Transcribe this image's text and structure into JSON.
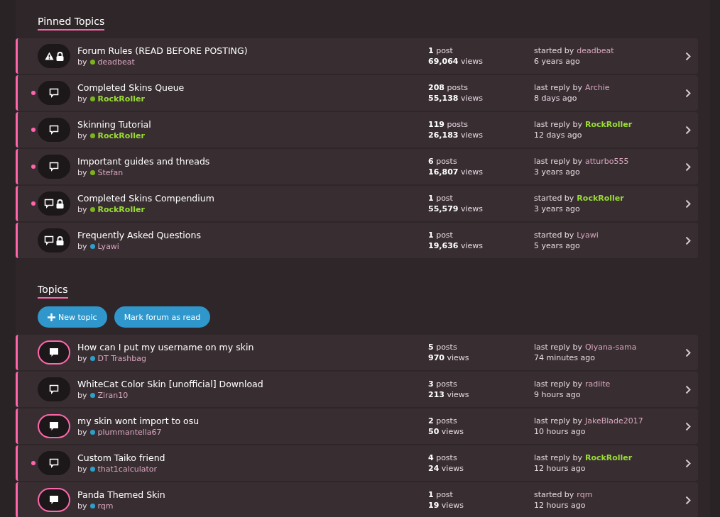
{
  "sections": [
    {
      "title": "Pinned Topics",
      "topics": [
        {
          "title": "Forum Rules (READ BEFORE POSTING)",
          "warning": true,
          "locked": true,
          "unread": false,
          "new_replies": false,
          "by_label": "by",
          "author": {
            "name": "deadbeat",
            "color": "#7ab51d",
            "group_colored": false
          },
          "posts": "**1** post",
          "views": "**69,064** views",
          "last": {
            "label": "started by",
            "name": "deadbeat",
            "group_colored": false,
            "time": "6 years ago"
          }
        },
        {
          "title": "Completed Skins Queue",
          "warning": false,
          "locked": false,
          "unread": true,
          "new_replies": false,
          "by_label": "by",
          "author": {
            "name": "RockRoller",
            "color": "#7ab51d",
            "group_colored": true
          },
          "posts": "**208** posts",
          "views": "**55,138** views",
          "last": {
            "label": "last reply by",
            "name": "Archie",
            "group_colored": false,
            "time": "8 days ago"
          }
        },
        {
          "title": "Skinning Tutorial",
          "warning": false,
          "locked": false,
          "unread": true,
          "new_replies": false,
          "by_label": "by",
          "author": {
            "name": "RockRoller",
            "color": "#7ab51d",
            "group_colored": true
          },
          "posts": "**119** posts",
          "views": "**26,183** views",
          "last": {
            "label": "last reply by",
            "name": "RockRoller",
            "group_colored": true,
            "time": "12 days ago"
          }
        },
        {
          "title": "Important guides and threads",
          "warning": false,
          "locked": false,
          "unread": true,
          "new_replies": false,
          "by_label": "by",
          "author": {
            "name": "Stefan",
            "color": "#7ab51d",
            "group_colored": false
          },
          "posts": "**6** posts",
          "views": "**16,807** views",
          "last": {
            "label": "last reply by",
            "name": "atturbo555",
            "group_colored": false,
            "time": "3 years ago"
          }
        },
        {
          "title": "Completed Skins Compendium",
          "warning": false,
          "locked": true,
          "unread": true,
          "new_replies": false,
          "by_label": "by",
          "author": {
            "name": "RockRoller",
            "color": "#7ab51d",
            "group_colored": true
          },
          "posts": "**1** post",
          "views": "**55,579** views",
          "last": {
            "label": "started by",
            "name": "RockRoller",
            "group_colored": true,
            "time": "3 years ago"
          }
        },
        {
          "title": "Frequently Asked Questions",
          "warning": false,
          "locked": true,
          "unread": false,
          "new_replies": false,
          "by_label": "by",
          "author": {
            "name": "Lyawi",
            "color": "#2d9fc9",
            "group_colored": false
          },
          "posts": "**1** post",
          "views": "**19,636** views",
          "last": {
            "label": "started by",
            "name": "Lyawi",
            "group_colored": false,
            "time": "5 years ago"
          }
        }
      ]
    },
    {
      "title": "Topics",
      "buttons": [
        {
          "kind": "new",
          "label": "New topic"
        },
        {
          "kind": "plain",
          "label": "Mark forum as read"
        }
      ],
      "topics": [
        {
          "title": "How can I put my username on my skin",
          "warning": false,
          "locked": false,
          "unread": false,
          "new_replies": true,
          "by_label": "by",
          "author": {
            "name": "DT Trashbag",
            "color": "#2d9fc9",
            "group_colored": false
          },
          "posts": "**5** posts",
          "views": "**970** views",
          "last": {
            "label": "last reply by",
            "name": "Qiyana-sama",
            "group_colored": false,
            "time": "74 minutes ago"
          }
        },
        {
          "title": "WhiteCat Color Skin [unofficial] Download",
          "warning": false,
          "locked": false,
          "unread": false,
          "new_replies": false,
          "by_label": "by",
          "author": {
            "name": "Ziran10",
            "color": "#2d9fc9",
            "group_colored": false
          },
          "posts": "**3** posts",
          "views": "**213** views",
          "last": {
            "label": "last reply by",
            "name": "radiite",
            "group_colored": false,
            "time": "9 hours ago"
          }
        },
        {
          "title": "my skin wont import to osu",
          "warning": false,
          "locked": false,
          "unread": false,
          "new_replies": true,
          "by_label": "by",
          "author": {
            "name": "plummantella67",
            "color": "#2d9fc9",
            "group_colored": false
          },
          "posts": "**2** posts",
          "views": "**50** views",
          "last": {
            "label": "last reply by",
            "name": "JakeBlade2017",
            "group_colored": false,
            "time": "10 hours ago"
          }
        },
        {
          "title": "Custom Taiko friend",
          "warning": false,
          "locked": false,
          "unread": true,
          "new_replies": false,
          "by_label": "by",
          "author": {
            "name": "that1calculator",
            "color": "#2d9fc9",
            "group_colored": false
          },
          "posts": "**4** posts",
          "views": "**24** views",
          "last": {
            "label": "last reply by",
            "name": "RockRoller",
            "group_colored": true,
            "time": "12 hours ago"
          }
        },
        {
          "title": "Panda Themed Skin",
          "warning": false,
          "locked": false,
          "unread": false,
          "new_replies": true,
          "by_label": "by",
          "author": {
            "name": "rqm",
            "color": "#2d9fc9",
            "group_colored": false
          },
          "posts": "**1** post",
          "views": "**19** views",
          "last": {
            "label": "started by",
            "name": "rqm",
            "group_colored": false,
            "time": "12 hours ago"
          }
        }
      ]
    }
  ]
}
